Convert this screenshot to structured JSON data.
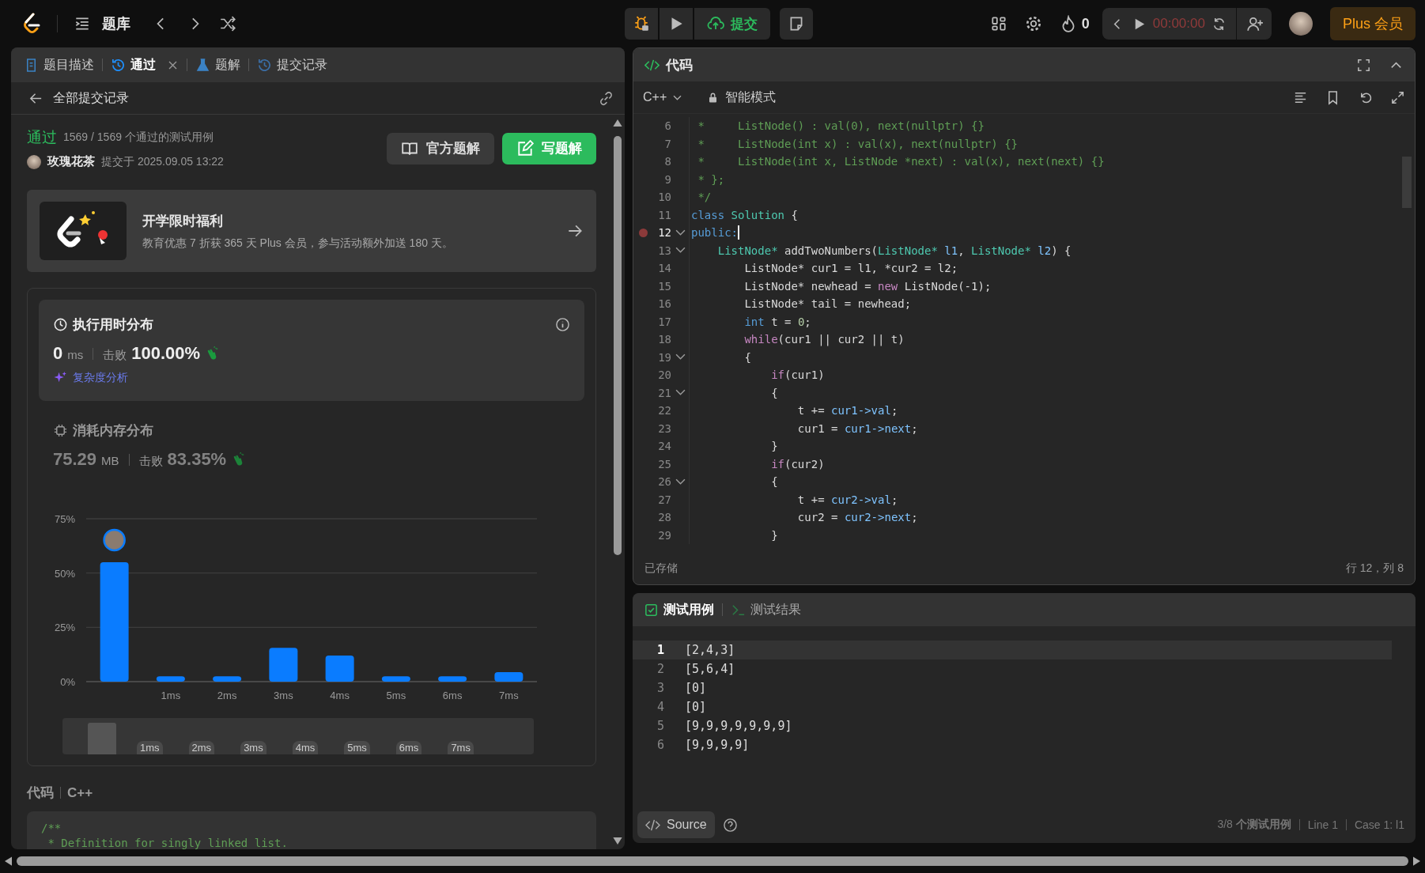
{
  "top_bar": {
    "nav_title": "题库",
    "submit_label": "提交",
    "streak": "0",
    "timer": "00:00:00",
    "plus_label": "Plus 会员"
  },
  "left_panel": {
    "tabs": [
      {
        "label": "题目描述",
        "kind": "doc",
        "selected": false,
        "closable": false
      },
      {
        "label": "通过",
        "kind": "history",
        "selected": true,
        "closable": true
      },
      {
        "label": "题解",
        "kind": "flask",
        "selected": false,
        "closable": false
      },
      {
        "label": "提交记录",
        "kind": "history",
        "selected": false,
        "closable": false
      }
    ],
    "back_label": "全部提交记录",
    "result": {
      "status": "通过",
      "cases": "1569 / 1569 个通过的测试用例",
      "user": "玫瑰花茶",
      "submitted": "提交于 2025.09.05 13:22",
      "buttons": [
        {
          "label": "官方题解",
          "kind": "secondary"
        },
        {
          "label": "写题解",
          "kind": "primary"
        }
      ]
    },
    "promo": {
      "title": "开学限时福利",
      "text": "教育优惠 7 折获 365 天 Plus 会员，参与活动额外加送 180 天。"
    },
    "stats": [
      {
        "kind": "runtime",
        "selected": true,
        "title": "执行用时分布",
        "value": "0",
        "unit": "ms",
        "beats_label": "击败",
        "beats": "100.00%",
        "link": "复杂度分析"
      },
      {
        "kind": "memory",
        "selected": false,
        "title": "消耗内存分布",
        "value": "75.29",
        "unit": "MB",
        "beats_label": "击败",
        "beats": "83.35%"
      }
    ],
    "chart_data": {
      "type": "bar",
      "categories": [
        null,
        "1ms",
        "2ms",
        "3ms",
        "4ms",
        "5ms",
        "6ms",
        "7ms"
      ],
      "series": [
        {
          "color": "#0a7cff",
          "values": [
            55,
            2.5,
            2.5,
            15.6,
            12,
            2.5,
            2.5,
            4.4
          ]
        }
      ],
      "ylim": [
        0,
        75
      ],
      "yticks": [
        {
          "value": 0,
          "label": "0%"
        },
        {
          "value": 25,
          "label": "25%"
        },
        {
          "value": 50,
          "label": "50%"
        },
        {
          "value": 75,
          "label": "75%"
        }
      ]
    },
    "navigator": {
      "labels": [
        "1ms",
        "2ms",
        "3ms",
        "4ms",
        "5ms",
        "6ms",
        "7ms"
      ]
    },
    "code": {
      "title": "代码",
      "language": "C++",
      "lines": [
        "/**",
        " * Definition for singly linked list."
      ]
    }
  },
  "editor": {
    "title": "代码",
    "language": "C++",
    "mode": "智能模式",
    "status": "已存储",
    "cursor": "行 12，列 8",
    "lines": [
      {
        "n": "6",
        "fold": false,
        "breakpoint": false,
        "current": false,
        "tokens": [
          {
            "kind": "cm",
            "t": " *     ListNode() : val(0), next(nullptr) {}"
          }
        ]
      },
      {
        "n": "7",
        "fold": false,
        "breakpoint": false,
        "current": false,
        "tokens": [
          {
            "kind": "cm",
            "t": " *     ListNode(int x) : val(x), next(nullptr) {}"
          }
        ]
      },
      {
        "n": "8",
        "fold": false,
        "breakpoint": false,
        "current": false,
        "tokens": [
          {
            "kind": "cm",
            "t": " *     ListNode(int x, ListNode *next) : val(x), next(next) {}"
          }
        ]
      },
      {
        "n": "9",
        "fold": false,
        "breakpoint": false,
        "current": false,
        "tokens": [
          {
            "kind": "cm",
            "t": " * };"
          }
        ]
      },
      {
        "n": "10",
        "fold": false,
        "breakpoint": false,
        "current": false,
        "tokens": [
          {
            "kind": "cm",
            "t": " */"
          }
        ]
      },
      {
        "n": "11",
        "fold": false,
        "breakpoint": false,
        "current": false,
        "tokens": [
          {
            "kind": "kw",
            "t": "class"
          },
          {
            "kind": "ty",
            "t": " Solution"
          },
          {
            "kind": "tx",
            "t": " {"
          }
        ]
      },
      {
        "n": "12",
        "fold": true,
        "breakpoint": true,
        "current": true,
        "tokens": [
          {
            "kind": "kw",
            "t": "public:"
          }
        ]
      },
      {
        "n": "13",
        "fold": true,
        "breakpoint": false,
        "current": false,
        "tokens": [
          {
            "kind": "ty",
            "t": "    ListNode*"
          },
          {
            "kind": "tx",
            "t": " addTwoNumbers("
          },
          {
            "kind": "ty",
            "t": "ListNode*"
          },
          {
            "kind": "vr",
            "t": " l1"
          },
          {
            "kind": "tx",
            "t": ", "
          },
          {
            "kind": "ty",
            "t": "ListNode*"
          },
          {
            "kind": "vr",
            "t": " l2"
          },
          {
            "kind": "tx",
            "t": ") {"
          }
        ]
      },
      {
        "n": "14",
        "fold": false,
        "breakpoint": false,
        "current": false,
        "tokens": [
          {
            "kind": "tx",
            "t": "        ListNode* cur1 = l1, *cur2 = l2;"
          }
        ]
      },
      {
        "n": "15",
        "fold": false,
        "breakpoint": false,
        "current": false,
        "tokens": [
          {
            "kind": "tx",
            "t": "        ListNode* newhead = "
          },
          {
            "kind": "ct",
            "t": "new"
          },
          {
            "kind": "tx",
            "t": " ListNode(-1);"
          }
        ]
      },
      {
        "n": "16",
        "fold": false,
        "breakpoint": false,
        "current": false,
        "tokens": [
          {
            "kind": "tx",
            "t": "        ListNode* tail = newhead;"
          }
        ]
      },
      {
        "n": "17",
        "fold": false,
        "breakpoint": false,
        "current": false,
        "tokens": [
          {
            "kind": "kw",
            "t": "        int"
          },
          {
            "kind": "tx",
            "t": " t = "
          },
          {
            "kind": "nm",
            "t": "0"
          },
          {
            "kind": "tx",
            "t": ";"
          }
        ]
      },
      {
        "n": "18",
        "fold": false,
        "breakpoint": false,
        "current": false,
        "tokens": [
          {
            "kind": "ct",
            "t": "        while"
          },
          {
            "kind": "tx",
            "t": "(cur1 || cur2 || t)"
          }
        ]
      },
      {
        "n": "19",
        "fold": true,
        "breakpoint": false,
        "current": false,
        "tokens": [
          {
            "kind": "tx",
            "t": "        {"
          }
        ]
      },
      {
        "n": "20",
        "fold": false,
        "breakpoint": false,
        "current": false,
        "tokens": [
          {
            "kind": "ct",
            "t": "            if"
          },
          {
            "kind": "tx",
            "t": "(cur1)"
          }
        ]
      },
      {
        "n": "21",
        "fold": true,
        "breakpoint": false,
        "current": false,
        "tokens": [
          {
            "kind": "tx",
            "t": "            {"
          }
        ]
      },
      {
        "n": "22",
        "fold": false,
        "breakpoint": false,
        "current": false,
        "tokens": [
          {
            "kind": "tx",
            "t": "                t += "
          },
          {
            "kind": "vr",
            "t": "cur1->val"
          },
          {
            "kind": "tx",
            "t": ";"
          }
        ]
      },
      {
        "n": "23",
        "fold": false,
        "breakpoint": false,
        "current": false,
        "tokens": [
          {
            "kind": "tx",
            "t": "                cur1 = "
          },
          {
            "kind": "vr",
            "t": "cur1->next"
          },
          {
            "kind": "tx",
            "t": ";"
          }
        ]
      },
      {
        "n": "24",
        "fold": false,
        "breakpoint": false,
        "current": false,
        "tokens": [
          {
            "kind": "tx",
            "t": "            }"
          }
        ]
      },
      {
        "n": "25",
        "fold": false,
        "breakpoint": false,
        "current": false,
        "tokens": [
          {
            "kind": "ct",
            "t": "            if"
          },
          {
            "kind": "tx",
            "t": "(cur2)"
          }
        ]
      },
      {
        "n": "26",
        "fold": true,
        "breakpoint": false,
        "current": false,
        "tokens": [
          {
            "kind": "tx",
            "t": "            {"
          }
        ]
      },
      {
        "n": "27",
        "fold": false,
        "breakpoint": false,
        "current": false,
        "tokens": [
          {
            "kind": "tx",
            "t": "                t += "
          },
          {
            "kind": "vr",
            "t": "cur2->val"
          },
          {
            "kind": "tx",
            "t": ";"
          }
        ]
      },
      {
        "n": "28",
        "fold": false,
        "breakpoint": false,
        "current": false,
        "tokens": [
          {
            "kind": "tx",
            "t": "                cur2 = "
          },
          {
            "kind": "vr",
            "t": "cur2->next"
          },
          {
            "kind": "tx",
            "t": ";"
          }
        ]
      },
      {
        "n": "29",
        "fold": false,
        "breakpoint": false,
        "current": false,
        "tokens": [
          {
            "kind": "tx",
            "t": "            }"
          }
        ]
      }
    ]
  },
  "testcases": {
    "tabs": [
      {
        "label": "测试用例",
        "kind": "check",
        "selected": true
      },
      {
        "label": "测试结果",
        "kind": "terminal",
        "selected": false
      }
    ],
    "lines": [
      {
        "n": "1",
        "text": "[2,4,3]",
        "current": true
      },
      {
        "n": "2",
        "text": "[5,6,4]",
        "current": false
      },
      {
        "n": "3",
        "text": "[0]",
        "current": false
      },
      {
        "n": "4",
        "text": "[0]",
        "current": false
      },
      {
        "n": "5",
        "text": "[9,9,9,9,9,9,9]",
        "current": false
      },
      {
        "n": "6",
        "text": "[9,9,9,9]",
        "current": false
      }
    ],
    "source_label": "Source",
    "footer": [
      "3/8 **个测试用例**",
      "Line 1",
      "Case 1: l1"
    ]
  }
}
